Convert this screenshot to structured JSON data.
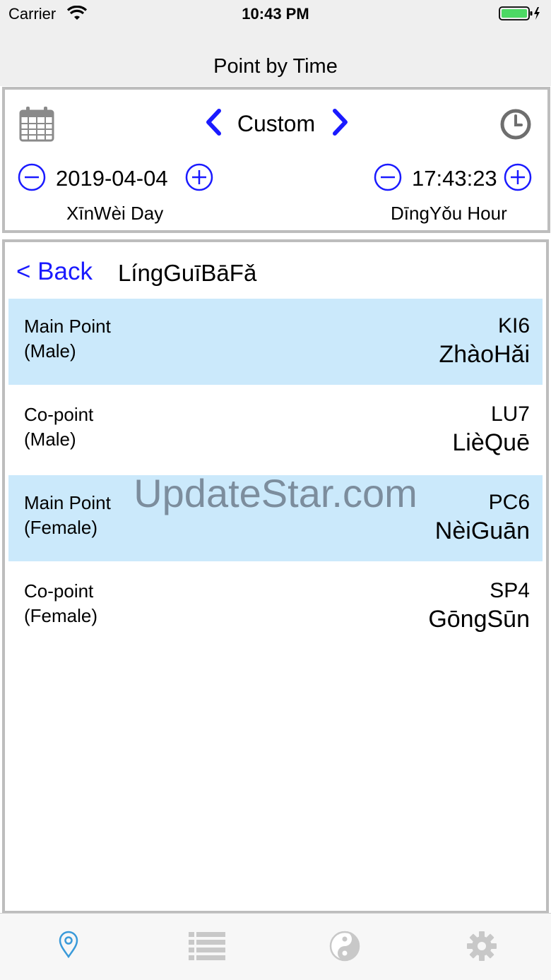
{
  "status_bar": {
    "carrier": "Carrier",
    "time": "10:43 PM"
  },
  "nav": {
    "title": "Point by Time"
  },
  "selector": {
    "mode": "Custom",
    "date": "2019-04-04",
    "day_name": "XīnWèi Day",
    "time": "17:43:23",
    "hour_name": "DīngYǒu Hour"
  },
  "list": {
    "back_label": "< Back",
    "title": "LíngGuīBāFǎ",
    "rows": [
      {
        "label_line1": "Main Point",
        "label_line2": "(Male)",
        "code": "KI6",
        "name": "ZhàoHǎi",
        "highlighted": true
      },
      {
        "label_line1": "Co-point",
        "label_line2": "(Male)",
        "code": "LU7",
        "name": "LièQuē",
        "highlighted": false
      },
      {
        "label_line1": "Main Point",
        "label_line2": "(Female)",
        "code": "PC6",
        "name": "NèiGuān",
        "highlighted": true
      },
      {
        "label_line1": "Co-point",
        "label_line2": "(Female)",
        "code": "SP4",
        "name": "GōngSūn",
        "highlighted": false
      }
    ]
  },
  "watermark": "UpdateStar.com",
  "tabbar": {
    "tabs": [
      {
        "icon": "location-pin-icon",
        "active": true
      },
      {
        "icon": "list-icon",
        "active": false
      },
      {
        "icon": "yin-yang-icon",
        "active": false
      },
      {
        "icon": "gear-icon",
        "active": false
      }
    ]
  },
  "colors": {
    "accent": "#1a1aff",
    "highlight_row": "#cbe9fb",
    "active_tab": "#3a9ad9",
    "inactive_tab": "#c8c8c8"
  }
}
